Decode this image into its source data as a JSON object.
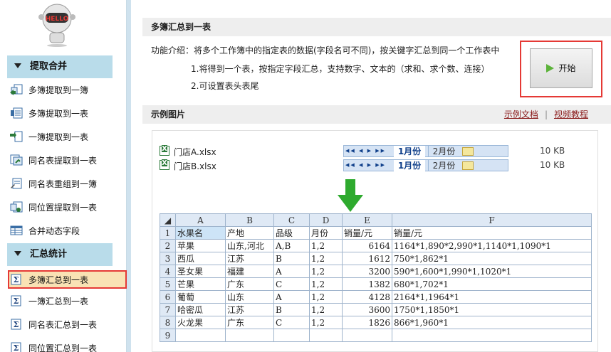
{
  "mascot": {
    "badge_text": "HELLO"
  },
  "sidebar": {
    "sections": [
      {
        "title": "提取合并"
      },
      {
        "title": "汇总统计"
      }
    ],
    "items": [
      {
        "label": "多簿提取到一簿",
        "icon": "extract-books-icon"
      },
      {
        "label": "多簿提取到一表",
        "icon": "extract-sheet-icon"
      },
      {
        "label": "一簿提取到一表",
        "icon": "single-book-icon"
      },
      {
        "label": "同名表提取到一表",
        "icon": "same-name-icon"
      },
      {
        "label": "同名表重组到一簿",
        "icon": "regroup-icon"
      },
      {
        "label": "同位置提取到一表",
        "icon": "same-position-icon"
      },
      {
        "label": "合并动态字段",
        "icon": "merge-fields-icon"
      },
      {
        "label": "多簿汇总到一表",
        "icon": "sigma-icon"
      },
      {
        "label": "一簿汇总到一表",
        "icon": "sigma-icon"
      },
      {
        "label": "同名表汇总到一表",
        "icon": "sigma-icon"
      },
      {
        "label": "同位置汇总到一表",
        "icon": "sigma-icon"
      }
    ]
  },
  "main": {
    "title": "多簿汇总到一表",
    "intro": "功能介绍：将多个工作簿中的指定表的数据(字段名可不同)，按关键字汇总到同一个工作表中",
    "bullets": [
      "1.将得到一个表，按指定字段汇总，支持数字、文本的（求和、求个数、连接）",
      "2.可设置表头表尾"
    ],
    "start_label": "开始",
    "example_title": "示例图片",
    "link_docs": "示例文档",
    "link_sep": "|",
    "link_video": "视频教程"
  },
  "example": {
    "files": [
      {
        "name": "门店A.xlsx",
        "tab1": "1月份",
        "tab2": "2月份",
        "size": "10 KB"
      },
      {
        "name": "门店B.xlsx",
        "tab1": "1月份",
        "tab2": "2月份",
        "size": "10 KB"
      }
    ],
    "nav_arrows": "◀◀ ◀ ▶ ▶▶",
    "col_headers": [
      "A",
      "B",
      "C",
      "D",
      "E",
      "F"
    ],
    "rows": [
      [
        "1",
        "水果名",
        "产地",
        "品级",
        "月份",
        "销量/元",
        "销量/元"
      ],
      [
        "2",
        "苹果",
        "山东,河北",
        "A,B",
        "1,2",
        "6164",
        "1164*1,890*2,990*1,1140*1,1090*1"
      ],
      [
        "3",
        "西瓜",
        "江苏",
        "B",
        "1,2",
        "1612",
        "750*1,862*1"
      ],
      [
        "4",
        "圣女果",
        "福建",
        "A",
        "1,2",
        "3200",
        "590*1,600*1,990*1,1020*1"
      ],
      [
        "5",
        "芒果",
        "广东",
        "C",
        "1,2",
        "1382",
        "680*1,702*1"
      ],
      [
        "6",
        "葡萄",
        "山东",
        "A",
        "1,2",
        "4128",
        "2164*1,1964*1"
      ],
      [
        "7",
        "哈密瓜",
        "江苏",
        "B",
        "1,2",
        "3600",
        "1750*1,1850*1"
      ],
      [
        "8",
        "火龙果",
        "广东",
        "C",
        "1,2",
        "1826",
        "866*1,960*1"
      ],
      [
        "9",
        "",
        "",
        "",
        "",
        "",
        ""
      ]
    ]
  },
  "colors": {
    "accent": "#b9dcea",
    "highlight": "#e53935",
    "active_bg": "#f9e2b4",
    "arrow": "#2eaa2e"
  }
}
